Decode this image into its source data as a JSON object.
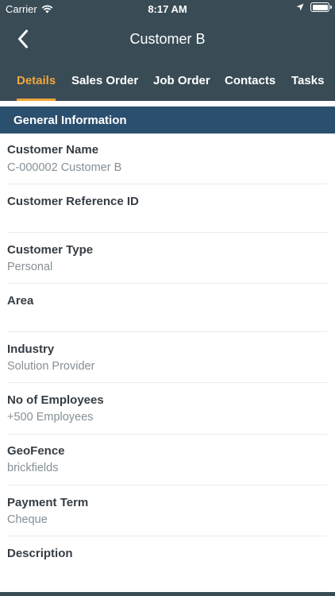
{
  "status_bar": {
    "carrier": "Carrier",
    "time": "8:17 AM"
  },
  "nav": {
    "title": "Customer B"
  },
  "tabs": [
    {
      "label": "Details",
      "active": true
    },
    {
      "label": "Sales Order",
      "active": false
    },
    {
      "label": "Job Order",
      "active": false
    },
    {
      "label": "Contacts",
      "active": false
    },
    {
      "label": "Tasks",
      "active": false
    }
  ],
  "section": {
    "title": "General Information"
  },
  "fields": [
    {
      "label": "Customer Name",
      "value": "C-000002  Customer B"
    },
    {
      "label": "Customer Reference ID",
      "value": ""
    },
    {
      "label": "Customer Type",
      "value": "Personal"
    },
    {
      "label": "Area",
      "value": ""
    },
    {
      "label": "Industry",
      "value": "Solution Provider"
    },
    {
      "label": "No of Employees",
      "value": "+500 Employees"
    },
    {
      "label": "GeoFence",
      "value": "brickfields"
    },
    {
      "label": "Payment Term",
      "value": "Cheque"
    },
    {
      "label": "Description",
      "value": ""
    }
  ],
  "colors": {
    "header": "#394b55",
    "section_bar": "#2b4f6e",
    "active_tab": "#f0a63b",
    "label_text": "#353d44",
    "value_text": "#858f96"
  },
  "icons": {
    "wifi": "wifi-icon",
    "location": "location-arrow-icon",
    "battery": "battery-icon",
    "back": "chevron-left-icon"
  }
}
